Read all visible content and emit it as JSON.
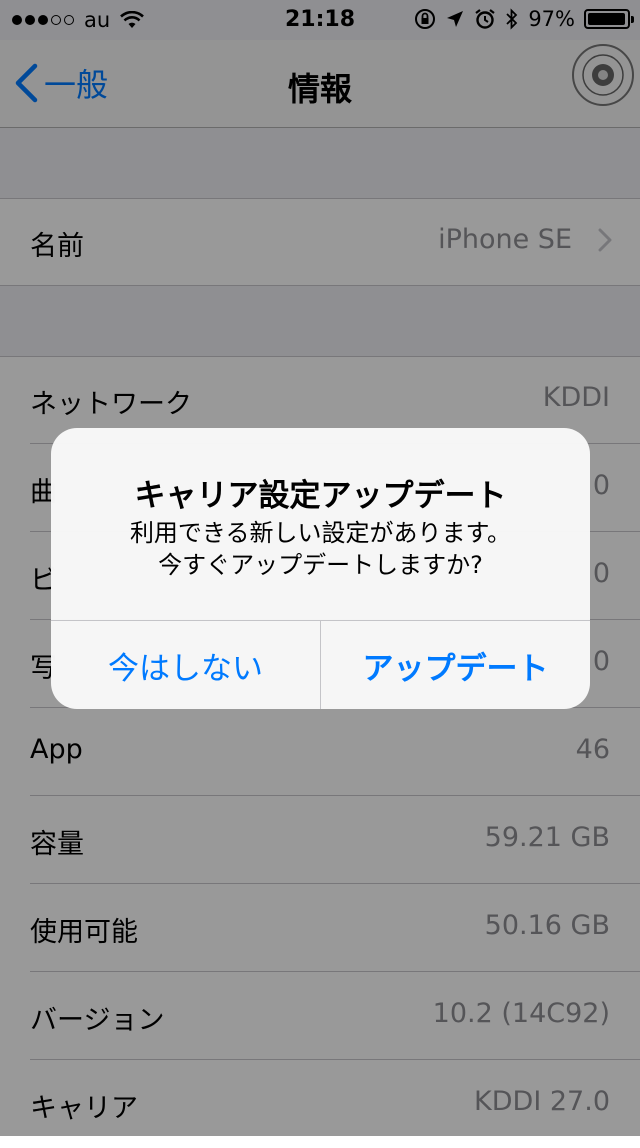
{
  "status_bar": {
    "carrier": "au",
    "time": "21:18",
    "battery": "97%",
    "battery_level": 0.97
  },
  "nav": {
    "back_label": "一般",
    "title": "情報"
  },
  "rows": [
    {
      "label": "名前",
      "value": "iPhone SE",
      "chevron": true
    },
    {
      "label": "ネットワーク",
      "value": "KDDI"
    },
    {
      "label": "曲",
      "value": "0"
    },
    {
      "label": "ビ",
      "value": "0"
    },
    {
      "label": "写",
      "value": "0"
    },
    {
      "label": "App",
      "value": "46"
    },
    {
      "label": "容量",
      "value": "59.21 GB"
    },
    {
      "label": "使用可能",
      "value": "50.16 GB"
    },
    {
      "label": "バージョン",
      "value": "10.2 (14C92)"
    },
    {
      "label": "キャリア",
      "value": "KDDI 27.0"
    }
  ],
  "alert": {
    "title": "キャリア設定アップデート",
    "message_line1": "利用できる新しい設定があります。",
    "message_line2": "今すぐアップデートしますか?",
    "cancel_label": "今はしない",
    "update_label": "アップデート"
  },
  "colors": {
    "tint": "#007aff",
    "secondary_text": "#8e8e93",
    "group_background": "#efeff4"
  }
}
